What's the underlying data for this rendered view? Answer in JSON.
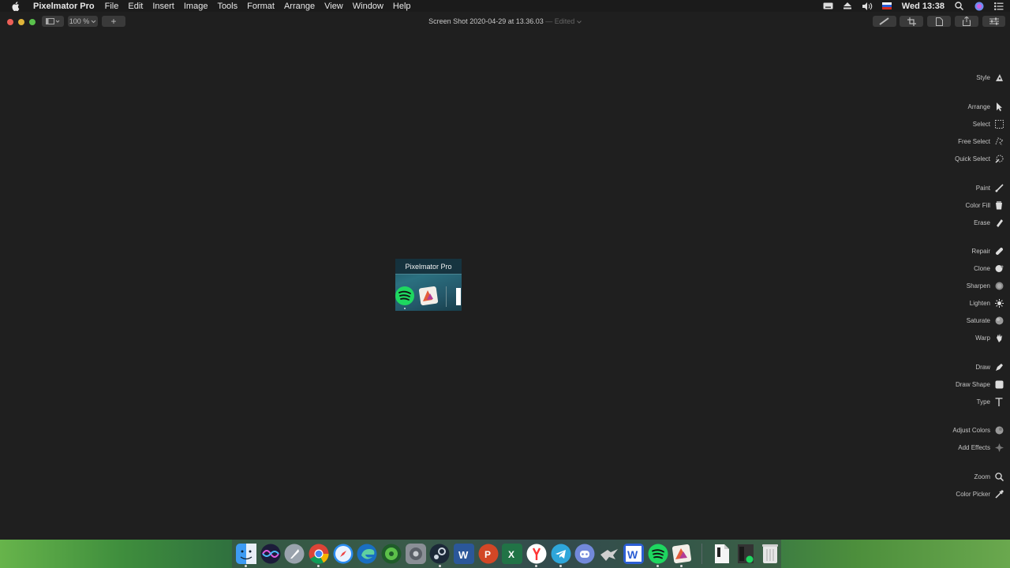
{
  "menubar": {
    "app_name": "Pixelmator Pro",
    "items": [
      "File",
      "Edit",
      "Insert",
      "Image",
      "Tools",
      "Format",
      "Arrange",
      "View",
      "Window",
      "Help"
    ],
    "clock": "Wed 13:38"
  },
  "toolbar": {
    "zoom": "100 %",
    "add_label": "+",
    "doc_title": "Screen Shot 2020-04-29 at 13.36.03",
    "doc_status": "— Edited"
  },
  "tools": [
    {
      "label": "Style",
      "icon": "style-icon"
    },
    {
      "label": "Arrange",
      "icon": "arrow-cursor-icon"
    },
    {
      "label": "Select",
      "icon": "rect-select-icon"
    },
    {
      "label": "Free Select",
      "icon": "lasso-icon"
    },
    {
      "label": "Quick Select",
      "icon": "quick-select-icon"
    },
    {
      "label": "Paint",
      "icon": "brush-icon"
    },
    {
      "label": "Color Fill",
      "icon": "bucket-icon"
    },
    {
      "label": "Erase",
      "icon": "eraser-icon"
    },
    {
      "label": "Repair",
      "icon": "bandage-icon"
    },
    {
      "label": "Clone",
      "icon": "clone-icon"
    },
    {
      "label": "Sharpen",
      "icon": "sharpen-icon"
    },
    {
      "label": "Lighten",
      "icon": "sun-icon"
    },
    {
      "label": "Saturate",
      "icon": "saturate-icon"
    },
    {
      "label": "Warp",
      "icon": "hand-icon"
    },
    {
      "label": "Draw",
      "icon": "pen-icon"
    },
    {
      "label": "Draw Shape",
      "icon": "shape-icon"
    },
    {
      "label": "Type",
      "icon": "type-icon"
    },
    {
      "label": "Adjust Colors",
      "icon": "adjust-colors-icon"
    },
    {
      "label": "Add Effects",
      "icon": "effects-icon"
    },
    {
      "label": "Zoom",
      "icon": "magnifier-icon"
    },
    {
      "label": "Color Picker",
      "icon": "eyedropper-icon"
    }
  ],
  "dock_preview": {
    "tooltip": "Pixelmator Pro"
  },
  "dock": {
    "apps": [
      "finder",
      "siri",
      "launchpad",
      "chrome",
      "safari",
      "edge",
      "silverlock",
      "system-preferences",
      "steam",
      "word",
      "powerpoint",
      "excel",
      "yandex",
      "telegram",
      "discord",
      "vpn",
      "webstorm",
      "spotify",
      "pixelmator-pro"
    ],
    "right_items": [
      "document",
      "terminal-preview",
      "trash"
    ]
  },
  "colors": {
    "background": "#1f1f1f",
    "traffic_red": "#ec5f57",
    "traffic_yellow": "#dfb43a",
    "traffic_green": "#5ac14c"
  }
}
